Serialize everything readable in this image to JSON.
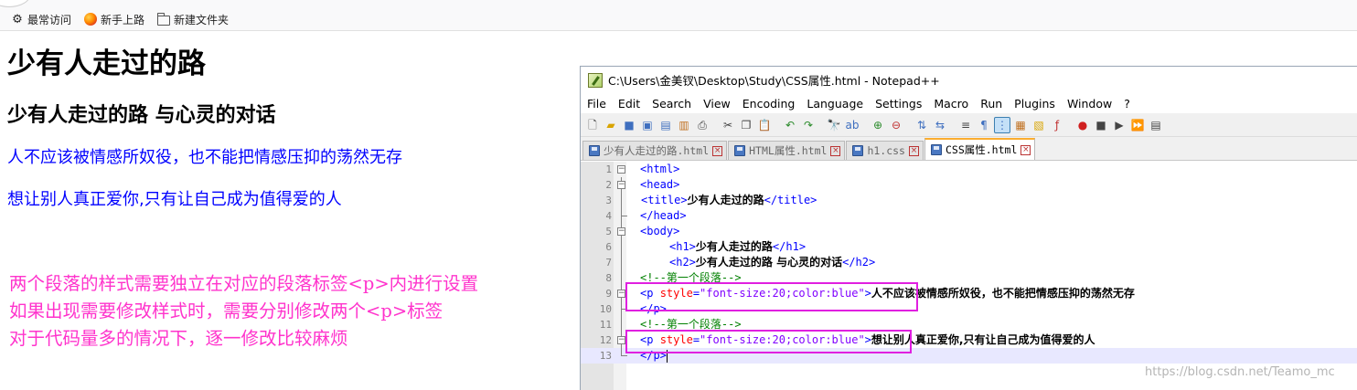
{
  "bookmarks": {
    "items": [
      {
        "label": "最常访问",
        "icon": "gear-icon"
      },
      {
        "label": "新手上路",
        "icon": "firefox-icon"
      },
      {
        "label": "新建文件夹",
        "icon": "folder-icon"
      }
    ]
  },
  "page": {
    "h1": "少有人走过的路",
    "h2": "少有人走过的路 与心灵的对话",
    "p1": "人不应该被情感所奴役，也不能把情感压抑的荡然无存",
    "p2": "想让别人真正爱你,只有让自己成为值得爱的人"
  },
  "annotation": {
    "line1": "两个段落的样式需要独立在对应的段落标签<p>内进行设置",
    "line2": "如果出现需要修改样式时，需要分别修改两个<p>标签",
    "line3": "对于代码量多的情况下，逐一修改比较麻烦"
  },
  "notepad": {
    "title": "C:\\Users\\金美钗\\Desktop\\Study\\CSS属性.html - Notepad++",
    "menu": [
      "File",
      "Edit",
      "Search",
      "View",
      "Encoding",
      "Language",
      "Settings",
      "Macro",
      "Run",
      "Plugins",
      "Window",
      "?"
    ],
    "tabs": [
      {
        "label": "少有人走过的路.html",
        "active": false
      },
      {
        "label": "HTML属性.html",
        "active": false
      },
      {
        "label": "h1.css",
        "active": false
      },
      {
        "label": "CSS属性.html",
        "active": true
      }
    ],
    "code": {
      "l1_tag": "<html>",
      "l2_tag": "<head>",
      "l3_open": "<title>",
      "l3_text": "少有人走过的路",
      "l3_close": "</title>",
      "l4_tag": "</head>",
      "l5_tag": "<body>",
      "l6_open": "<h1>",
      "l6_text": "少有人走过的路",
      "l6_close": "</h1>",
      "l7_open": "<h2>",
      "l7_text": "少有人走过的路 与心灵的对话",
      "l7_close": "</h2>",
      "l8_comment": "<!--第一个段落-->",
      "l9_p": "<p ",
      "l9_attr": "style",
      "l9_eq": "=",
      "l9_val": "\"font-size:20;color:blue\"",
      "l9_gt": ">",
      "l9_text": "人不应该被情感所奴役，也不能把情感压抑的荡然无存",
      "l10_tag": "</p>",
      "l11_comment": "<!--第一个段落-->",
      "l12_p": "<p ",
      "l12_attr": "style",
      "l12_eq": "=",
      "l12_val": "\"font-size:20;color:blue\"",
      "l12_gt": ">",
      "l12_text": "想让别人真正爱你,只有让自己成为值得爱的人",
      "l13_tag": "</p>"
    },
    "line_numbers": [
      "1",
      "2",
      "3",
      "4",
      "5",
      "6",
      "7",
      "8",
      "9",
      "10",
      "11",
      "12",
      "13"
    ]
  },
  "watermark": "https://blog.csdn.net/Teamo_mc",
  "colors": {
    "paragraph": "#0000ff",
    "annotation": "#ff33cc",
    "highlight_box": "#e020e0"
  }
}
